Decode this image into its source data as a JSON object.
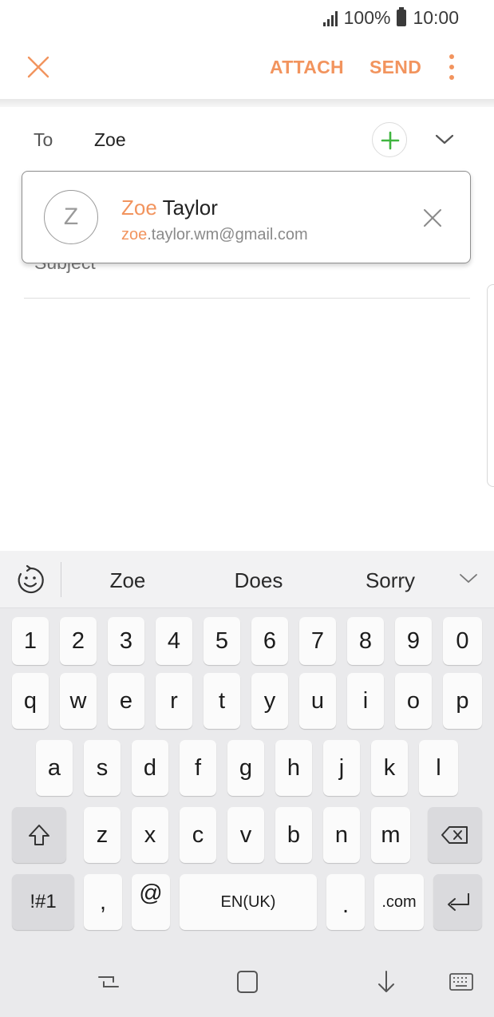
{
  "status_bar": {
    "battery_percent": "100%",
    "time": "10:00"
  },
  "app_bar": {
    "attach_label": "ATTACH",
    "send_label": "SEND",
    "accent_color": "#f2945e"
  },
  "compose": {
    "to_label": "To",
    "to_value": "Zoe",
    "subject_placeholder": "Subject"
  },
  "suggestion": {
    "avatar_initial": "Z",
    "name_match": "Zoe",
    "name_rest": " Taylor",
    "email_match": "zoe",
    "email_rest": ".taylor.wm@gmail.com"
  },
  "keyboard": {
    "suggestions": [
      "Zoe",
      "Does",
      "Sorry"
    ],
    "number_row": [
      "1",
      "2",
      "3",
      "4",
      "5",
      "6",
      "7",
      "8",
      "9",
      "0"
    ],
    "row1": [
      "q",
      "w",
      "e",
      "r",
      "t",
      "y",
      "u",
      "i",
      "o",
      "p"
    ],
    "row2": [
      "a",
      "s",
      "d",
      "f",
      "g",
      "h",
      "j",
      "k",
      "l"
    ],
    "row3": [
      "z",
      "x",
      "c",
      "v",
      "b",
      "n",
      "m"
    ],
    "symbols_key": "!#1",
    "comma_key": ",",
    "at_key": "@",
    "space_label": "EN(UK)",
    "period_key": ".",
    "dotcom_key": ".com"
  }
}
